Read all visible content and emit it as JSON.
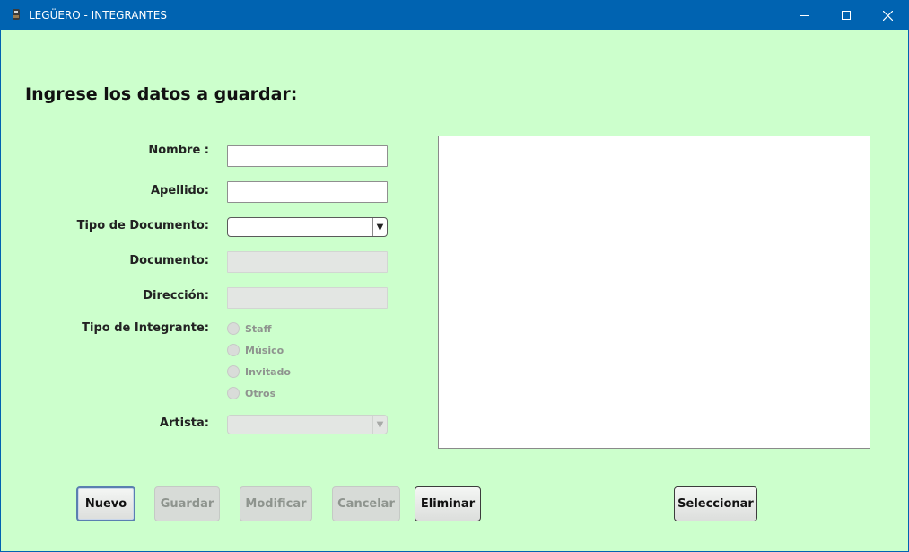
{
  "window": {
    "title": "LEGÜERO - INTEGRANTES",
    "accent": "#0063b1",
    "background": "#ccffcc",
    "controls": {
      "minimize": "minimize-icon",
      "maximize": "maximize-icon",
      "close": "close-icon"
    }
  },
  "form": {
    "heading": "Ingrese los datos a guardar:",
    "nombre": {
      "label": "Nombre :",
      "value": ""
    },
    "apellido": {
      "label": "Apellido:",
      "value": ""
    },
    "tipo_documento": {
      "label": "Tipo de Documento:",
      "selected": ""
    },
    "documento": {
      "label": "Documento:",
      "value": ""
    },
    "direccion": {
      "label": "Dirección:",
      "value": ""
    },
    "tipo_integrante": {
      "label": "Tipo de Integrante:",
      "options": [
        "Staff",
        "Músico",
        "Invitado",
        "Otros"
      ]
    },
    "artista": {
      "label": "Artista:",
      "selected": ""
    }
  },
  "buttons": {
    "nuevo": "Nuevo",
    "guardar": "Guardar",
    "modificar": "Modificar",
    "cancelar": "Cancelar",
    "eliminar": "Eliminar",
    "seleccionar": "Seleccionar"
  }
}
